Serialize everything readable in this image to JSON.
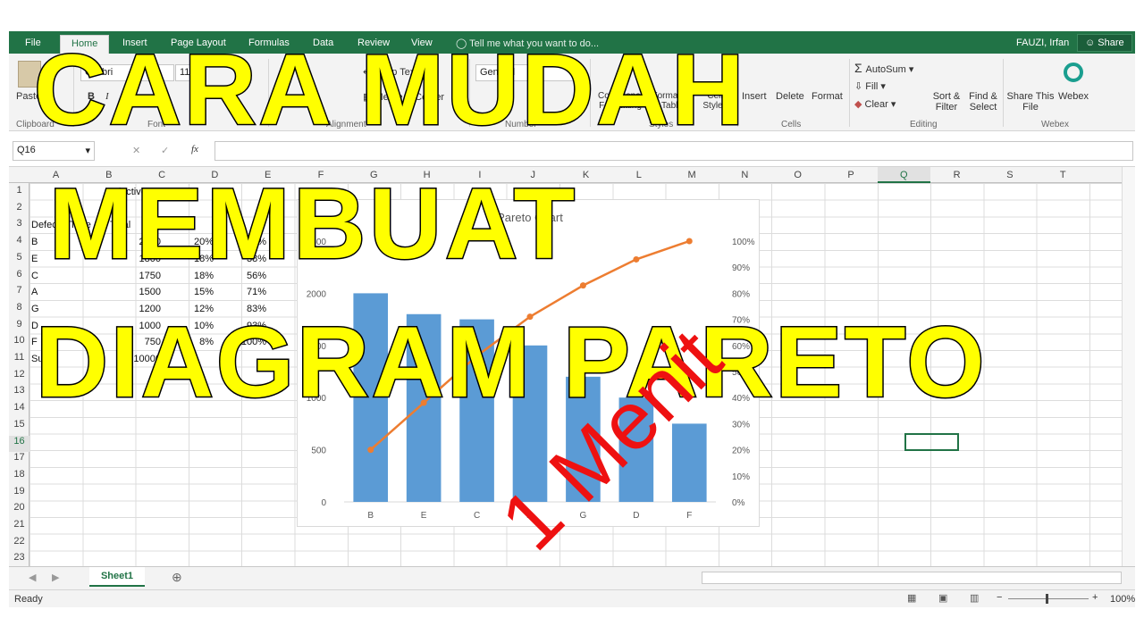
{
  "ribbon": {
    "tabs": [
      "File",
      "Home",
      "Insert",
      "Page Layout",
      "Formulas",
      "Data",
      "Review",
      "View"
    ],
    "active_tab": "Home",
    "tell_me": "Tell me what you want to do...",
    "user": "FAUZI, Irfan",
    "share": "Share",
    "clipboard": {
      "paste": "Paste",
      "group": "Clipboard"
    },
    "font": {
      "name": "Calibri",
      "size": "11",
      "bold": "B",
      "italic": "I",
      "group": "Font"
    },
    "alignment": {
      "wrap": "Wrap Text",
      "merge": "Merge & Center",
      "group": "Alignment"
    },
    "number": {
      "format": "General",
      "group": "Number"
    },
    "styles": {
      "conditional": "Conditional Formatting",
      "format_table": "Format as Table",
      "cell_styles": "Cell Styles",
      "group": "Styles"
    },
    "cells": {
      "insert": "Insert",
      "delete": "Delete",
      "format": "Format",
      "group": "Cells"
    },
    "editing": {
      "autosum": "AutoSum",
      "fill": "Fill",
      "clear": "Clear",
      "sort": "Sort & Filter",
      "find": "Find & Select",
      "group": "Editing"
    },
    "webex": {
      "share_file": "Share This File",
      "webex": "Webex",
      "group": "Webex"
    }
  },
  "formula_bar": {
    "name_box": "Q16",
    "fx": "fx",
    "value": ""
  },
  "columns": [
    "A",
    "B",
    "C",
    "D",
    "E",
    "F",
    "G",
    "H",
    "I",
    "J",
    "K",
    "L",
    "M",
    "N",
    "O",
    "P",
    "Q",
    "R",
    "S",
    "T"
  ],
  "selected_column": "Q",
  "rows": [
    "1",
    "2",
    "3",
    "4",
    "5",
    "6",
    "7",
    "8",
    "9",
    "10",
    "11",
    "12",
    "13",
    "14",
    "15",
    "16",
    "17",
    "18",
    "19",
    "20",
    "21",
    "22",
    "23"
  ],
  "selected_row": "16",
  "cells": {
    "b1": "Defective",
    "a3": "Defect",
    "a3b": "Type",
    "b3": "Total",
    "table": [
      {
        "type": "B",
        "total": "2000",
        "pct": "20%",
        "cum": "20%"
      },
      {
        "type": "E",
        "total": "1800",
        "pct": "18%",
        "cum": "38%"
      },
      {
        "type": "C",
        "total": "1750",
        "pct": "18%",
        "cum": "56%"
      },
      {
        "type": "A",
        "total": "1500",
        "pct": "15%",
        "cum": "71%"
      },
      {
        "type": "G",
        "total": "1200",
        "pct": "12%",
        "cum": "83%"
      },
      {
        "type": "D",
        "total": "1000",
        "pct": "10%",
        "cum": "93%"
      },
      {
        "type": "F",
        "total": "750",
        "pct": "8%",
        "cum": "100%"
      }
    ],
    "sum_label": "Sum",
    "sum_value": "10000"
  },
  "chart_data": {
    "type": "bar",
    "title": "Pareto Chart",
    "categories": [
      "B",
      "E",
      "C",
      "A",
      "G",
      "D",
      "F"
    ],
    "series": [
      {
        "type": "bar",
        "values": [
          2000,
          1800,
          1750,
          1500,
          1200,
          1000,
          750
        ],
        "color": "#5b9bd5"
      },
      {
        "type": "line",
        "axis": "secondary",
        "values": [
          20,
          38,
          56,
          71,
          83,
          93,
          100
        ],
        "color": "#ed7d31"
      }
    ],
    "ylim": [
      0,
      2500
    ],
    "yticks": [
      "0",
      "500",
      "1000",
      "1500",
      "2000",
      "2500"
    ],
    "y2lim": [
      0,
      100
    ],
    "y2ticks": [
      "0%",
      "10%",
      "20%",
      "30%",
      "40%",
      "50%",
      "60%",
      "70%",
      "80%",
      "90%",
      "100%"
    ],
    "grid": false
  },
  "sheet_tab": "Sheet1",
  "status": {
    "ready": "Ready",
    "zoom": "100%"
  },
  "overlay": {
    "line1": "CARA MUDAH",
    "line2": "MEMBUAT",
    "line3": "DIAGRAM PARETO",
    "menit": "1 Menit",
    "title_color": "#ffff00",
    "menit_color": "#ee1111"
  }
}
